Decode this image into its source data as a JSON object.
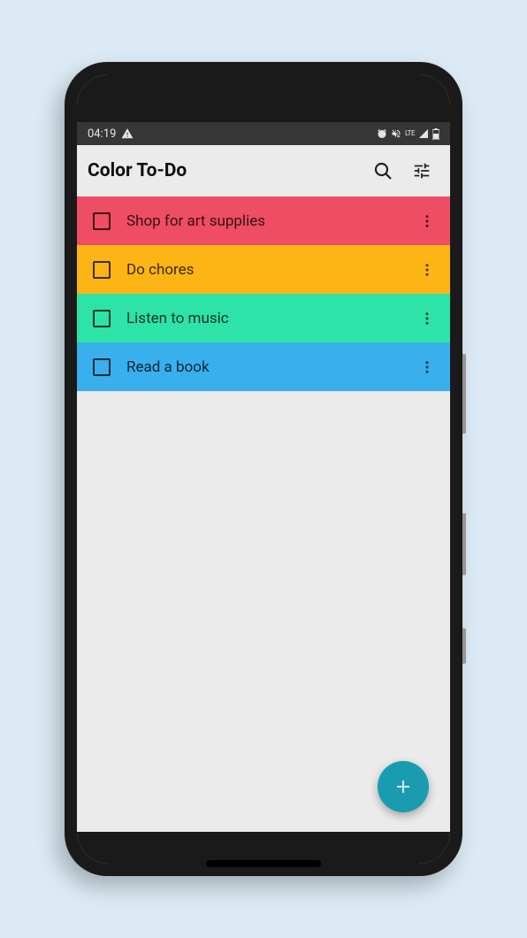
{
  "statusbar": {
    "time": "04:19",
    "indicators": "⏰ 🔇 LTE 📶 🔋"
  },
  "topbar": {
    "title": "Color To-Do"
  },
  "todos": [
    {
      "label": "Shop for art supplies",
      "color": "#ef4d63"
    },
    {
      "label": "Do chores",
      "color": "#fcb514"
    },
    {
      "label": "Listen to music",
      "color": "#2de3a7"
    },
    {
      "label": "Read a book",
      "color": "#3aafed"
    }
  ]
}
